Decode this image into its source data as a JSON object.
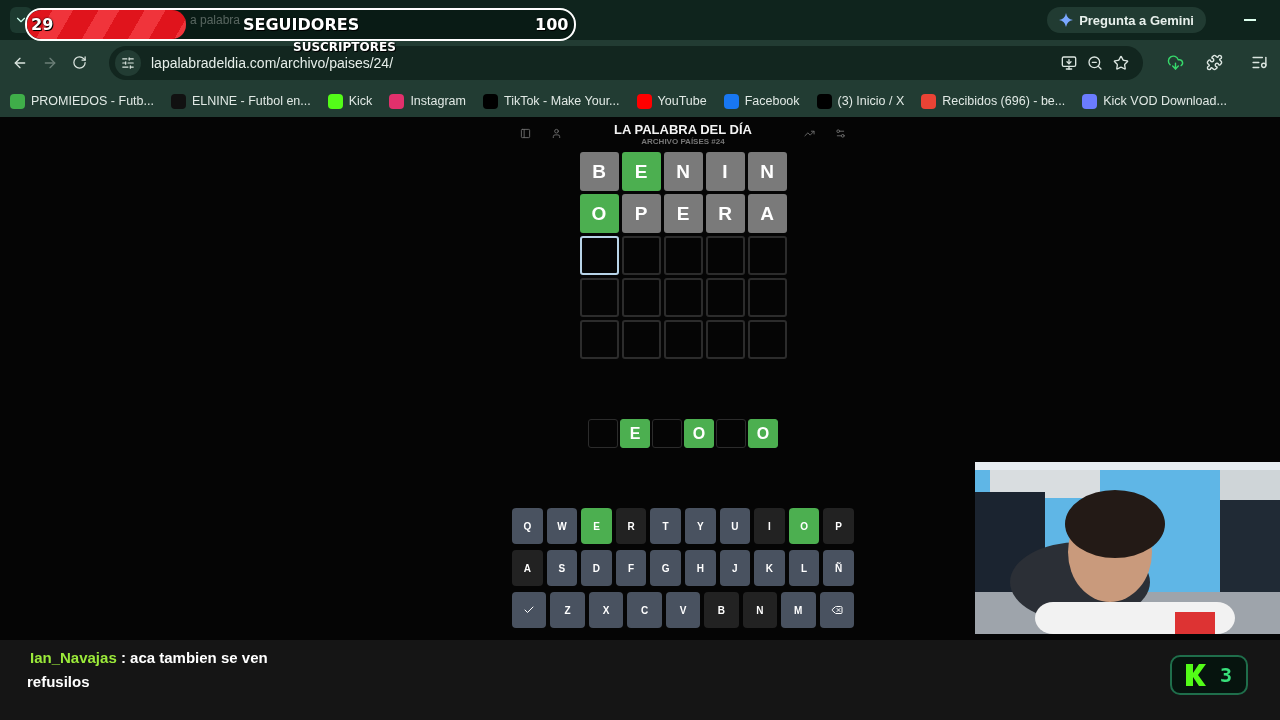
{
  "browser": {
    "tab_title": "a palabra",
    "gemini_button": "Pregunta a Gemini",
    "url": "lapalabradeldia.com/archivo/paises/24/",
    "bookmarks": [
      {
        "label": "PROMIEDOS - Futb...",
        "color": "#3fae49"
      },
      {
        "label": "ELNINE - Futbol en...",
        "color": "#111111"
      },
      {
        "label": "Kick",
        "color": "#53fc18"
      },
      {
        "label": "Instagram",
        "color": "#e1306c"
      },
      {
        "label": "TikTok - Make Your...",
        "color": "#000000"
      },
      {
        "label": "YouTube",
        "color": "#ff0000"
      },
      {
        "label": "Facebook",
        "color": "#1877f2"
      },
      {
        "label": "(3) Inicio / X",
        "color": "#000000"
      },
      {
        "label": "Recibidos (696) - be...",
        "color": "#ea4335"
      },
      {
        "label": "Kick VOD Download...",
        "color": "#6b7cff"
      }
    ]
  },
  "overlay": {
    "followers": {
      "current": "29",
      "label": "SEGUIDORES",
      "goal": "100",
      "level": 0.29
    },
    "subscribers_label": "SUSCRIPTORES"
  },
  "game": {
    "title": "LA PALABRA DEL DÍA",
    "subtitle": "ARCHIVO PAÍSES #24",
    "board": [
      [
        {
          "letter": "B",
          "kind": "absent"
        },
        {
          "letter": "E",
          "kind": "correct"
        },
        {
          "letter": "N",
          "kind": "absent"
        },
        {
          "letter": "I",
          "kind": "absent"
        },
        {
          "letter": "N",
          "kind": "absent"
        }
      ],
      [
        {
          "letter": "O",
          "kind": "correct"
        },
        {
          "letter": "P",
          "kind": "absent"
        },
        {
          "letter": "E",
          "kind": "absent"
        },
        {
          "letter": "R",
          "kind": "absent"
        },
        {
          "letter": "A",
          "kind": "absent"
        }
      ],
      [
        {
          "kind": "active"
        },
        {
          "kind": "empty"
        },
        {
          "kind": "empty"
        },
        {
          "kind": "empty"
        },
        {
          "kind": "empty"
        }
      ],
      [
        {
          "kind": "empty"
        },
        {
          "kind": "empty"
        },
        {
          "kind": "empty"
        },
        {
          "kind": "empty"
        },
        {
          "kind": "empty"
        }
      ],
      [
        {
          "kind": "empty"
        },
        {
          "kind": "empty"
        },
        {
          "kind": "empty"
        },
        {
          "kind": "empty"
        },
        {
          "kind": "empty"
        }
      ]
    ],
    "solution": [
      {
        "kind": "empty"
      },
      {
        "letter": "E",
        "kind": "correct"
      },
      {
        "kind": "empty"
      },
      {
        "letter": "O",
        "kind": "correct"
      },
      {
        "kind": "empty"
      },
      {
        "letter": "O",
        "kind": "correct"
      }
    ],
    "keyboard": [
      [
        {
          "kind": "letter",
          "label": "Q",
          "color": "#495260"
        },
        {
          "kind": "letter",
          "label": "W",
          "color": "#495260"
        },
        {
          "kind": "letter",
          "label": "E",
          "color": "#4caf50"
        },
        {
          "kind": "letter",
          "label": "R",
          "color": "#222222"
        },
        {
          "kind": "letter",
          "label": "T",
          "color": "#495260"
        },
        {
          "kind": "letter",
          "label": "Y",
          "color": "#495260"
        },
        {
          "kind": "letter",
          "label": "U",
          "color": "#495260"
        },
        {
          "kind": "letter",
          "label": "I",
          "color": "#222222"
        },
        {
          "kind": "letter",
          "label": "O",
          "color": "#4caf50"
        },
        {
          "kind": "letter",
          "label": "P",
          "color": "#222222"
        }
      ],
      [
        {
          "kind": "letter",
          "label": "A",
          "color": "#222222"
        },
        {
          "kind": "letter",
          "label": "S",
          "color": "#495260"
        },
        {
          "kind": "letter",
          "label": "D",
          "color": "#495260"
        },
        {
          "kind": "letter",
          "label": "F",
          "color": "#495260"
        },
        {
          "kind": "letter",
          "label": "G",
          "color": "#495260"
        },
        {
          "kind": "letter",
          "label": "H",
          "color": "#495260"
        },
        {
          "kind": "letter",
          "label": "J",
          "color": "#495260"
        },
        {
          "kind": "letter",
          "label": "K",
          "color": "#495260"
        },
        {
          "kind": "letter",
          "label": "L",
          "color": "#495260"
        },
        {
          "kind": "letter",
          "label": "Ñ",
          "color": "#495260"
        }
      ],
      [
        {
          "kind": "enter",
          "color": "#495260"
        },
        {
          "kind": "letter",
          "label": "Z",
          "color": "#495260"
        },
        {
          "kind": "letter",
          "label": "X",
          "color": "#495260"
        },
        {
          "kind": "letter",
          "label": "C",
          "color": "#495260"
        },
        {
          "kind": "letter",
          "label": "V",
          "color": "#495260"
        },
        {
          "kind": "letter",
          "label": "B",
          "color": "#222222"
        },
        {
          "kind": "letter",
          "label": "N",
          "color": "#222222"
        },
        {
          "kind": "letter",
          "label": "M",
          "color": "#495260"
        },
        {
          "kind": "backspace",
          "color": "#495260"
        }
      ]
    ]
  },
  "chat": {
    "username": "Ian_Navajas",
    "message": ": aca tambien se ven refusilos"
  },
  "kick_badge": {
    "count": "3"
  }
}
